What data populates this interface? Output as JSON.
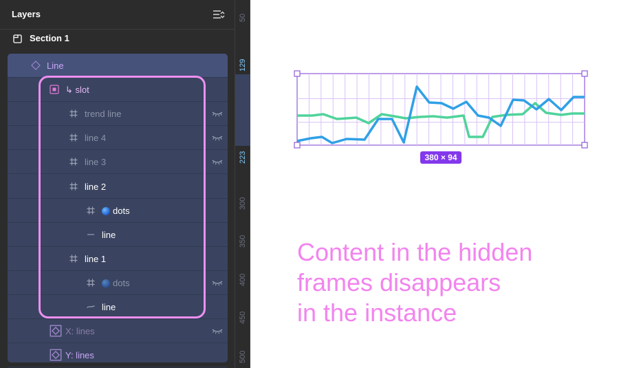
{
  "panel": {
    "title": "Layers",
    "section_label": "Section 1"
  },
  "layers": [
    {
      "label": "Line",
      "icon": "component-diamond-icon",
      "depth": 0,
      "color": "#c9a6f7",
      "hidden": false
    },
    {
      "label": "↳ slot",
      "icon": "slot-frame-icon",
      "depth": 1,
      "color": "#e9b8f5",
      "hidden": false
    },
    {
      "label": "trend line",
      "icon": "frame-hash-icon",
      "depth": 2,
      "color": "#8b92a8",
      "hidden": true
    },
    {
      "label": "line 4",
      "icon": "frame-hash-icon",
      "depth": 2,
      "color": "#8b92a8",
      "hidden": true
    },
    {
      "label": "line 3",
      "icon": "frame-hash-icon",
      "depth": 2,
      "color": "#8b92a8",
      "hidden": true
    },
    {
      "label": "line 2",
      "icon": "frame-hash-icon",
      "depth": 2,
      "color": "#ffffff",
      "hidden": false
    },
    {
      "label": "dots",
      "icon": "frame-hash-icon",
      "depth": 3,
      "color": "#ffffff",
      "hidden": false,
      "dot": true
    },
    {
      "label": "line",
      "icon": "line-dash-icon",
      "depth": 3,
      "color": "#ffffff",
      "hidden": false
    },
    {
      "label": "line 1",
      "icon": "frame-hash-icon",
      "depth": 2,
      "color": "#ffffff",
      "hidden": false
    },
    {
      "label": "dots",
      "icon": "frame-hash-icon",
      "depth": 3,
      "color": "#8b92a8",
      "hidden": true,
      "dot": true
    },
    {
      "label": "line",
      "icon": "vector-line-icon",
      "depth": 3,
      "color": "#ffffff",
      "hidden": false
    },
    {
      "label": "X: lines",
      "icon": "instance-diamond-icon",
      "depth": 1,
      "color": "#8b7ca8",
      "hidden": true
    },
    {
      "label": "Y: lines",
      "icon": "instance-diamond-icon",
      "depth": 1,
      "color": "#c9a6f7",
      "hidden": false
    }
  ],
  "ruler": {
    "ticks": [
      "50",
      "129",
      "223",
      "300",
      "350",
      "400",
      "450",
      "500"
    ],
    "highlighted": [
      "129",
      "223"
    ]
  },
  "canvas": {
    "dimension_badge": "380 × 94",
    "caption_lines": [
      "Content in the hidden",
      "frames disappears",
      "in the instance"
    ]
  },
  "colors": {
    "accent_purple": "#8338ec",
    "series_blue": "#2fa0e6",
    "series_green": "#4fd39a",
    "caption_pink": "#f284ee"
  }
}
